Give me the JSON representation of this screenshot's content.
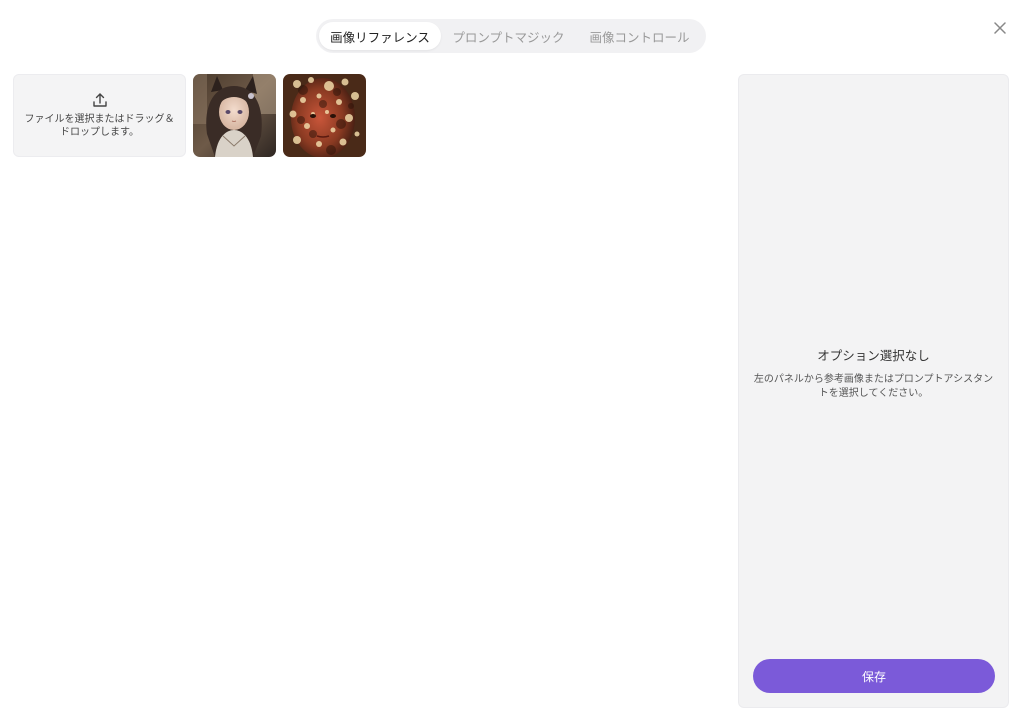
{
  "tabs": [
    {
      "label": "画像リファレンス",
      "active": true
    },
    {
      "label": "プロンプトマジック",
      "active": false
    },
    {
      "label": "画像コントロール",
      "active": false
    }
  ],
  "close_icon": "close-icon",
  "upload": {
    "icon": "upload-icon",
    "text": "ファイルを選択またはドラッグ＆ドロップします。"
  },
  "thumbnails": [
    {
      "name": "anime-girl-image"
    },
    {
      "name": "face-shadow-image"
    }
  ],
  "panel": {
    "title": "オプション選択なし",
    "description": "左のパネルから参考画像またはプロンプトアシスタントを選択してください。",
    "save_label": "保存"
  },
  "colors": {
    "accent": "#7b5ad9",
    "panel_bg": "#f3f3f4",
    "tab_bg": "#f1f1f3"
  }
}
